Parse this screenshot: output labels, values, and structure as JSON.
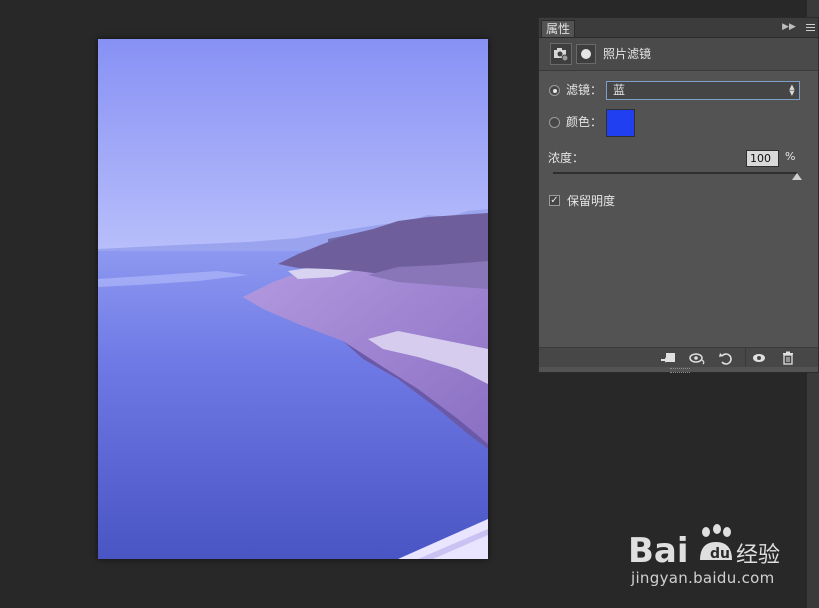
{
  "panel": {
    "tab_label": "属性",
    "collapse_icon": "double-chevron-right-icon",
    "menu_icon": "panel-menu-icon",
    "title": "照片滤镜",
    "header_icons": [
      "camera-adjustment-icon",
      "layer-mask-icon"
    ],
    "filter": {
      "label": "滤镜：",
      "selected": true,
      "value": "蓝"
    },
    "color": {
      "label": "颜色：",
      "selected": false,
      "swatch": "#1f3ff0"
    },
    "density": {
      "label": "浓度：",
      "value": "100",
      "unit": "%",
      "slider_fraction": 1.0
    },
    "preserve_luminosity": {
      "label": "保留明度",
      "checked": true
    },
    "footer_icons": [
      "clip-to-layer-icon",
      "view-previous-state-icon",
      "reset-icon",
      "visibility-eye-icon",
      "trash-icon"
    ]
  },
  "canvas": {
    "description_colors": {
      "sky_top": "#8c95f5",
      "sky_horizon": "#b7bdfb",
      "water": "#5560d6",
      "bank": "#9a7fd2"
    }
  },
  "watermark": {
    "logo_text": "Bai",
    "logo_suffix": "经验",
    "url": "jingyan.baidu.com"
  }
}
